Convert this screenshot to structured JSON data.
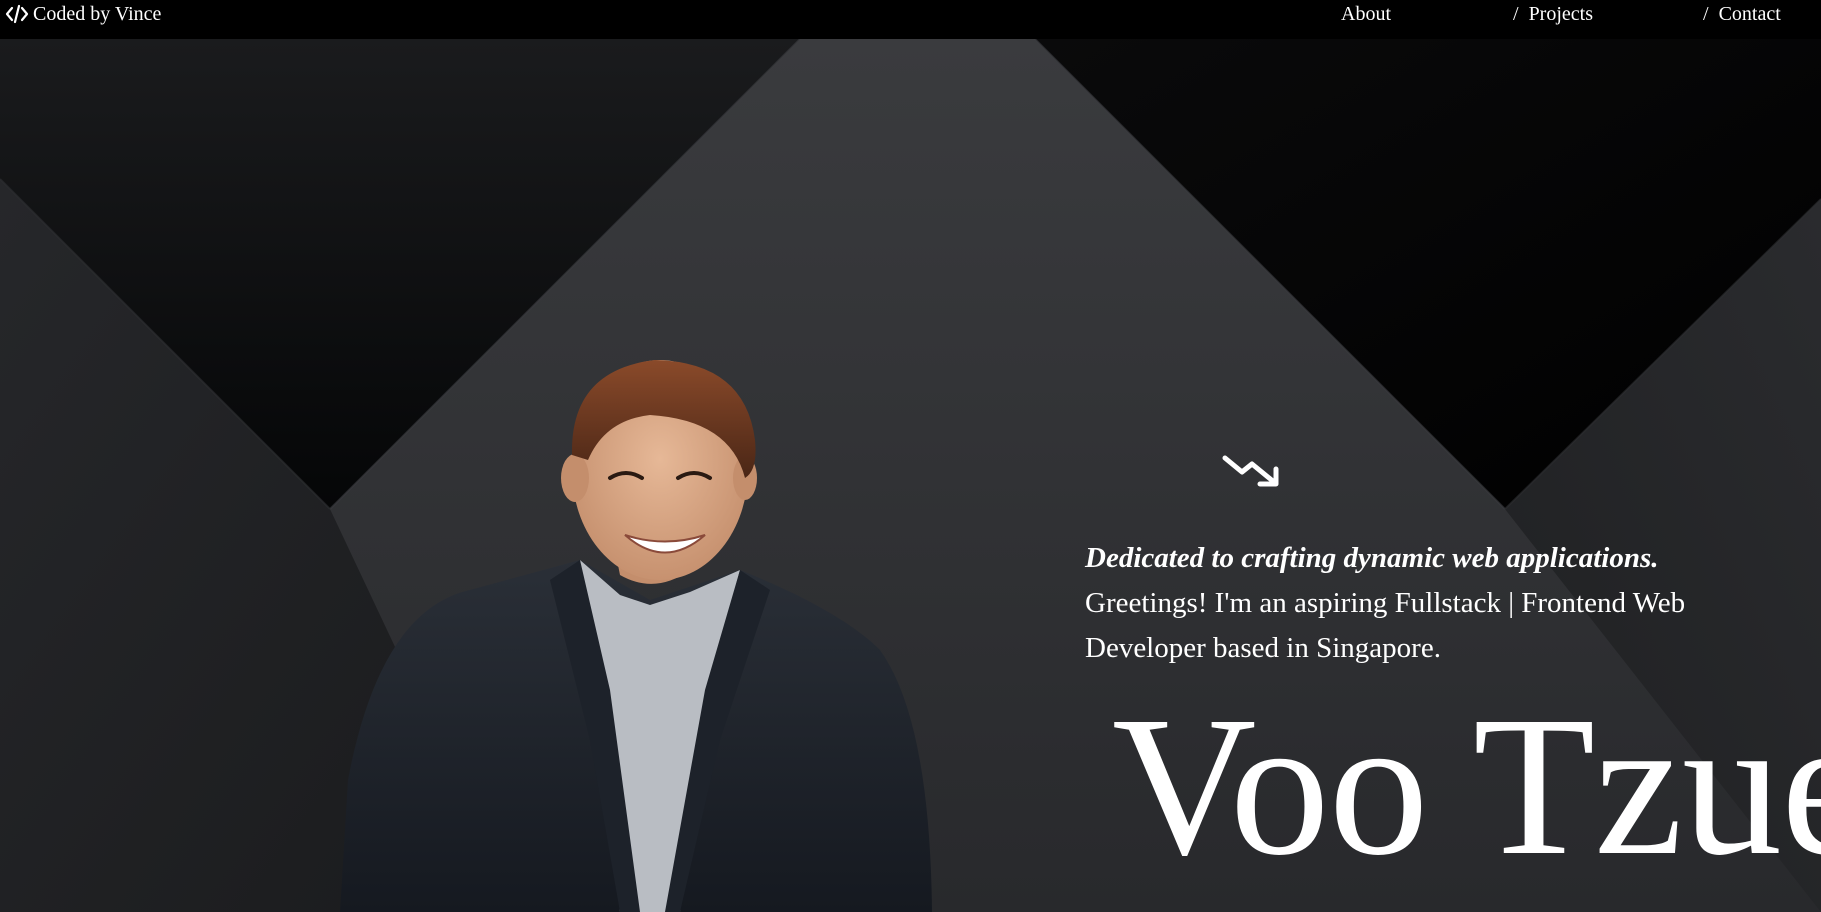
{
  "nav": {
    "brand": {
      "icon": "code-brackets-icon",
      "label": "Coded by Vince"
    },
    "links": {
      "about": "About",
      "projects": "Projects",
      "contact": "Contact",
      "separator": "/"
    }
  },
  "hero": {
    "scroll_icon": "trend-down-arrow-icon",
    "tagline": "Dedicated to crafting dynamic web applications.",
    "intro": "Greetings! I'm an aspiring Fullstack | Frontend Web Developer based in Singapore.",
    "name": "Voo Tzue",
    "portrait": "person-portrait-photo"
  },
  "colors": {
    "nav_background": "#000000",
    "text": "#ffffff",
    "hero_dark": "#050607",
    "hero_mid": "#2e2f32"
  }
}
